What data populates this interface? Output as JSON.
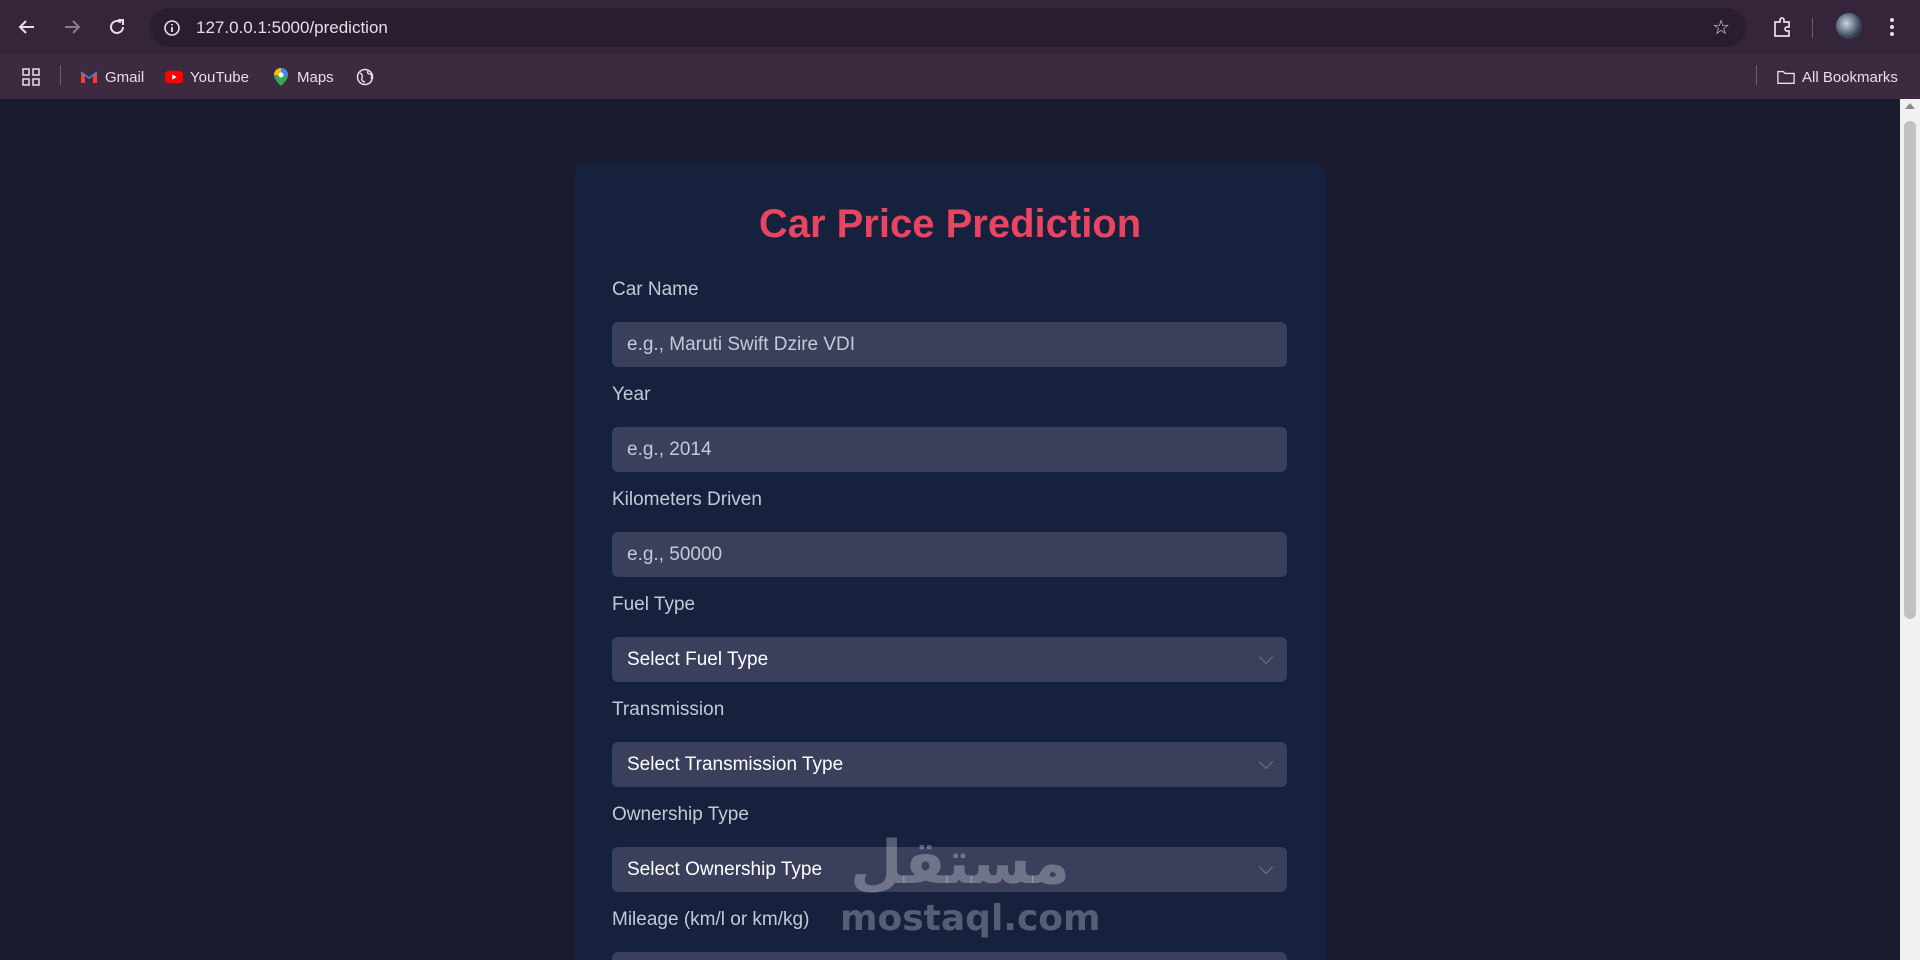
{
  "browser": {
    "url": "127.0.0.1:5000/prediction",
    "bookmarks": [
      {
        "label": "Gmail",
        "icon": "gmail-icon"
      },
      {
        "label": "YouTube",
        "icon": "youtube-icon"
      },
      {
        "label": "Maps",
        "icon": "maps-icon"
      }
    ],
    "all_bookmarks_label": "All Bookmarks"
  },
  "form": {
    "title": "Car Price Prediction",
    "fields": [
      {
        "label": "Car Name",
        "placeholder": "e.g., Maruti Swift Dzire VDI"
      },
      {
        "label": "Year",
        "placeholder": "e.g., 2014"
      },
      {
        "label": "Kilometers Driven",
        "placeholder": "e.g., 50000"
      },
      {
        "label": "Fuel Type",
        "selected": "Select Fuel Type"
      },
      {
        "label": "Transmission",
        "selected": "Select Transmission Type"
      },
      {
        "label": "Ownership Type",
        "selected": "Select Ownership Type"
      },
      {
        "label": "Mileage (km/l or km/kg)"
      }
    ]
  },
  "watermark": {
    "arabic": "مستقل",
    "latin": "mostaql.com"
  },
  "colors": {
    "accent": "#e94560",
    "page_bg": "#1a1b2e",
    "card_bg": "#16213e",
    "field_bg": "#3a3f5c"
  }
}
